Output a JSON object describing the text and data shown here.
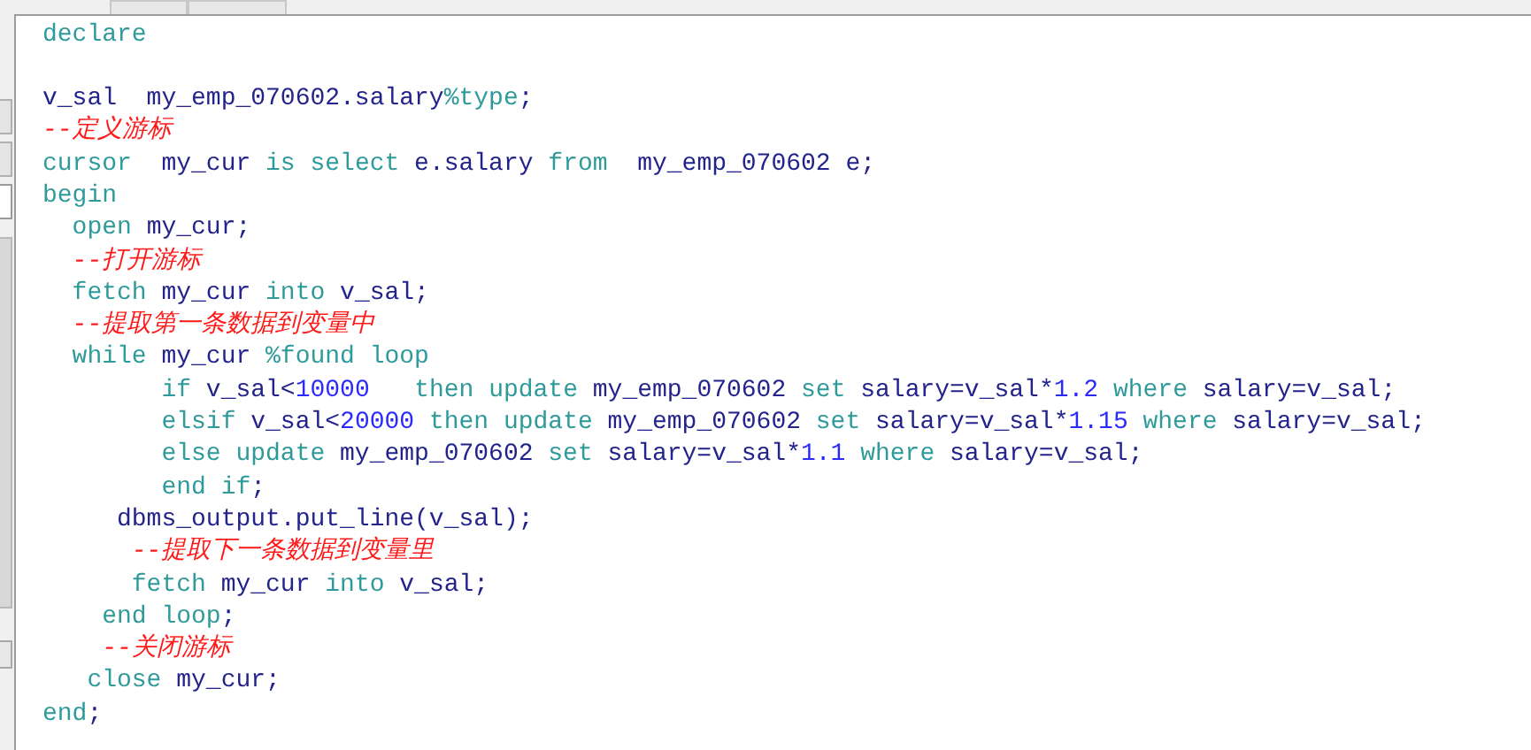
{
  "editor": {
    "lines": [
      {
        "kind": "code",
        "tokens": [
          {
            "kind": "keyword",
            "text": "declare"
          }
        ]
      },
      {
        "kind": "blank"
      },
      {
        "kind": "code",
        "tokens": [
          {
            "kind": "name",
            "text": "v_sal  my_emp_070602.salary"
          },
          {
            "kind": "keyword",
            "text": "%type"
          },
          {
            "kind": "name",
            "text": ";"
          }
        ]
      },
      {
        "kind": "code",
        "tokens": [
          {
            "kind": "comment",
            "text": "--定义游标"
          }
        ]
      },
      {
        "kind": "code",
        "tokens": [
          {
            "kind": "keyword",
            "text": "cursor  "
          },
          {
            "kind": "name",
            "text": "my_cur "
          },
          {
            "kind": "keyword",
            "text": "is select "
          },
          {
            "kind": "name",
            "text": "e.salary "
          },
          {
            "kind": "keyword",
            "text": "from  "
          },
          {
            "kind": "name",
            "text": "my_emp_070602 e;"
          }
        ]
      },
      {
        "kind": "code",
        "tokens": [
          {
            "kind": "keyword",
            "text": "begin"
          }
        ]
      },
      {
        "kind": "code",
        "tokens": [
          {
            "kind": "keyword",
            "text": "  open "
          },
          {
            "kind": "name",
            "text": "my_cur;"
          }
        ]
      },
      {
        "kind": "code",
        "tokens": [
          {
            "kind": "comment",
            "text": "  --打开游标"
          }
        ]
      },
      {
        "kind": "code",
        "tokens": [
          {
            "kind": "keyword",
            "text": "  fetch "
          },
          {
            "kind": "name",
            "text": "my_cur "
          },
          {
            "kind": "keyword",
            "text": "into "
          },
          {
            "kind": "name",
            "text": "v_sal;"
          }
        ]
      },
      {
        "kind": "code",
        "tokens": [
          {
            "kind": "comment",
            "text": "  --提取第一条数据到变量中"
          }
        ]
      },
      {
        "kind": "code",
        "tokens": [
          {
            "kind": "keyword",
            "text": "  while "
          },
          {
            "kind": "name",
            "text": "my_cur "
          },
          {
            "kind": "keyword",
            "text": "%found loop"
          }
        ]
      },
      {
        "kind": "code",
        "tokens": [
          {
            "kind": "keyword",
            "text": "        if "
          },
          {
            "kind": "name",
            "text": "v_sal<"
          },
          {
            "kind": "number",
            "text": "10000"
          },
          {
            "kind": "keyword",
            "text": "   then update "
          },
          {
            "kind": "name",
            "text": "my_emp_070602 "
          },
          {
            "kind": "keyword",
            "text": "set "
          },
          {
            "kind": "name",
            "text": "salary=v_sal*"
          },
          {
            "kind": "number",
            "text": "1.2"
          },
          {
            "kind": "keyword",
            "text": " where "
          },
          {
            "kind": "name",
            "text": "salary=v_sal;"
          }
        ]
      },
      {
        "kind": "code",
        "tokens": [
          {
            "kind": "keyword",
            "text": "        elsif "
          },
          {
            "kind": "name",
            "text": "v_sal<"
          },
          {
            "kind": "number",
            "text": "20000"
          },
          {
            "kind": "keyword",
            "text": " then update "
          },
          {
            "kind": "name",
            "text": "my_emp_070602 "
          },
          {
            "kind": "keyword",
            "text": "set "
          },
          {
            "kind": "name",
            "text": "salary=v_sal*"
          },
          {
            "kind": "number",
            "text": "1.15"
          },
          {
            "kind": "keyword",
            "text": " where "
          },
          {
            "kind": "name",
            "text": "salary=v_sal;"
          }
        ]
      },
      {
        "kind": "code",
        "tokens": [
          {
            "kind": "keyword",
            "text": "        else update "
          },
          {
            "kind": "name",
            "text": "my_emp_070602 "
          },
          {
            "kind": "keyword",
            "text": "set "
          },
          {
            "kind": "name",
            "text": "salary=v_sal*"
          },
          {
            "kind": "number",
            "text": "1.1"
          },
          {
            "kind": "keyword",
            "text": " where "
          },
          {
            "kind": "name",
            "text": "salary=v_sal;"
          }
        ]
      },
      {
        "kind": "code",
        "tokens": [
          {
            "kind": "keyword",
            "text": "        end if"
          },
          {
            "kind": "name",
            "text": ";"
          }
        ]
      },
      {
        "kind": "code",
        "tokens": [
          {
            "kind": "name",
            "text": "     dbms_output.put_line(v_sal);"
          }
        ]
      },
      {
        "kind": "code",
        "tokens": [
          {
            "kind": "comment",
            "text": "      --提取下一条数据到变量里"
          }
        ]
      },
      {
        "kind": "code",
        "tokens": [
          {
            "kind": "keyword",
            "text": "      fetch "
          },
          {
            "kind": "name",
            "text": "my_cur "
          },
          {
            "kind": "keyword",
            "text": "into "
          },
          {
            "kind": "name",
            "text": "v_sal;"
          }
        ]
      },
      {
        "kind": "code",
        "tokens": [
          {
            "kind": "keyword",
            "text": "    end loop"
          },
          {
            "kind": "name",
            "text": ";"
          }
        ]
      },
      {
        "kind": "code",
        "tokens": [
          {
            "kind": "comment",
            "text": "    --关闭游标"
          }
        ]
      },
      {
        "kind": "code",
        "tokens": [
          {
            "kind": "keyword",
            "text": "   close "
          },
          {
            "kind": "name",
            "text": "my_cur;"
          }
        ]
      },
      {
        "kind": "code",
        "tokens": [
          {
            "kind": "keyword",
            "text": "end"
          },
          {
            "kind": "name",
            "text": ";"
          }
        ]
      }
    ]
  }
}
